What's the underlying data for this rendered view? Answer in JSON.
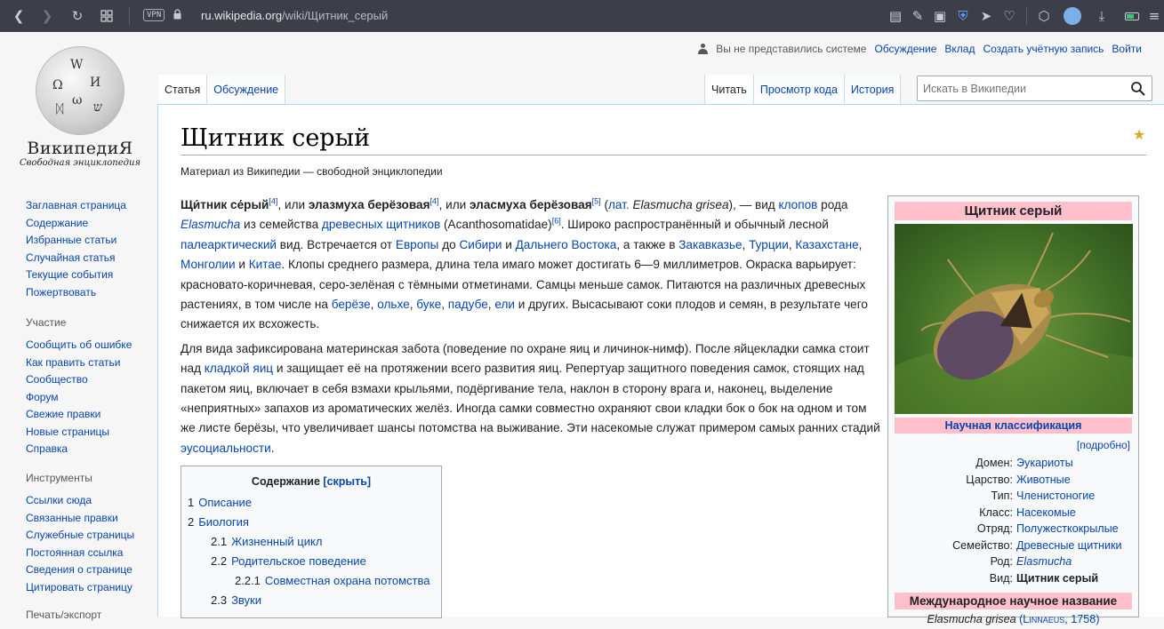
{
  "browser": {
    "vpn": "VPN",
    "url_host": "ru.wikipedia.org",
    "url_path": "/wiki/Щитник_серый"
  },
  "logo": {
    "wordmark": "ВикипедиЯ",
    "tagline": "Свободная энциклопедия"
  },
  "personal": {
    "not_logged": "Вы не представились системе",
    "links": [
      "Обсуждение",
      "Вклад",
      "Создать учётную запись",
      "Войти"
    ]
  },
  "nav": {
    "main": [
      "Заглавная страница",
      "Содержание",
      "Избранные статьи",
      "Случайная статья",
      "Текущие события",
      "Пожертвовать"
    ],
    "participation_heading": "Участие",
    "participation": [
      "Сообщить об ошибке",
      "Как править статьи",
      "Сообщество",
      "Форум",
      "Свежие правки",
      "Новые страницы",
      "Справка"
    ],
    "tools_heading": "Инструменты",
    "tools": [
      "Ссылки сюда",
      "Связанные правки",
      "Служебные страницы",
      "Постоянная ссылка",
      "Сведения о странице",
      "Цитировать страницу"
    ],
    "print_heading": "Печать/экспорт"
  },
  "tabs": {
    "left": [
      "Статья",
      "Обсуждение"
    ],
    "right": [
      "Читать",
      "Просмотр кода",
      "История"
    ]
  },
  "search": {
    "placeholder": "Искать в Википедии"
  },
  "article": {
    "title": "Щитник серый",
    "sitesub": "Материал из Википедии — свободной энциклопедии"
  },
  "toc": {
    "title": "Содержание",
    "toggle": "[скрыть]",
    "items": [
      {
        "num": "1",
        "label": "Описание"
      },
      {
        "num": "2",
        "label": "Биология"
      },
      {
        "num": "2.1",
        "label": "Жизненный цикл"
      },
      {
        "num": "2.2",
        "label": "Родительское поведение"
      },
      {
        "num": "2.2.1",
        "label": "Совместная охрана потомства"
      },
      {
        "num": "2.3",
        "label": "Звуки"
      }
    ]
  },
  "infobox": {
    "title": "Щитник серый",
    "classification": "Научная классификация",
    "more": "[подробно]",
    "rows": [
      {
        "k": "Домен:",
        "v": "Эукариоты"
      },
      {
        "k": "Царство:",
        "v": "Животные"
      },
      {
        "k": "Тип:",
        "v": "Членистоногие"
      },
      {
        "k": "Класс:",
        "v": "Насекомые"
      },
      {
        "k": "Отряд:",
        "v": "Полужесткокрылые"
      },
      {
        "k": "Семейство:",
        "v": "Древесные щитники"
      },
      {
        "k": "Род:",
        "v": "Elasmucha"
      },
      {
        "k": "Вид:",
        "v": "Щитник серый"
      }
    ],
    "intl_name": "Международное научное название",
    "latin": "Elasmucha grisea",
    "latin_author": "(Linnaeus, 1758)"
  },
  "colors": {
    "link": "#0645ad",
    "infobox_header": "#ffc0cb",
    "browser_bar": "#3c3f47"
  }
}
